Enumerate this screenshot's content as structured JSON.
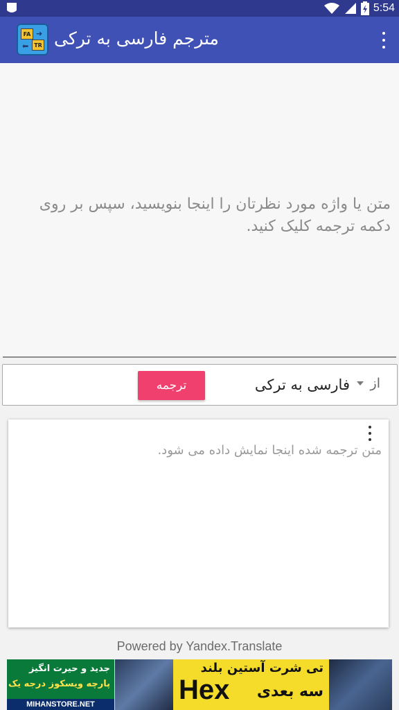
{
  "status_bar": {
    "time": "5:54",
    "icons": [
      "notification-icon",
      "wifi-icon",
      "signal-icon",
      "battery-icon"
    ]
  },
  "app_bar": {
    "icon": {
      "badge_top": "FA",
      "badge_bottom": "TR"
    },
    "title": "مترجم فارسی به ترکی",
    "menu_icon": "overflow-menu-icon"
  },
  "input": {
    "placeholder": "متن یا واژه مورد نظرتان را اینجا بنویسید، سپس بر روی دکمه ترجمه کلیک کنید."
  },
  "controls": {
    "from_label": "از",
    "language_selected": "فارسی به ترکی",
    "translate_label": "ترجمه"
  },
  "output": {
    "placeholder": "متن ترجمه شده اینجا نمایش داده می شود.",
    "menu_icon": "overflow-menu-icon"
  },
  "footer": {
    "powered_by": "Powered by Yandex.Translate"
  },
  "ad": {
    "line1": "جدید و حیرت انگیز",
    "line2": "پارچه ویسکوز درجه یک",
    "store": "MIHANSTORE.NET",
    "headline": "تی شرت آستین بلند",
    "brand": "Hex",
    "subline": "سه بعدی"
  },
  "colors": {
    "status_bar": "#2f3a8f",
    "app_bar": "#3f51b5",
    "accent": "#f0406e"
  }
}
